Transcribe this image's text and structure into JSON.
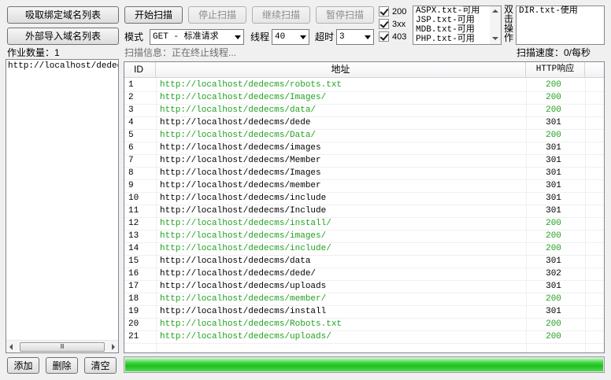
{
  "left_buttons": {
    "fetch_bound": "吸取绑定域名列表",
    "import_external": "外部导入域名列表"
  },
  "job_count_label": "作业数量：1",
  "job_list": [
    "http://localhost/dedecm"
  ],
  "bottom_buttons": {
    "add": "添加",
    "delete": "删除",
    "clear": "清空"
  },
  "toolbar": {
    "start": "开始扫描",
    "stop": "停止扫描",
    "resume": "继续扫描",
    "pause": "暂停扫描"
  },
  "options": {
    "mode_label": "模式",
    "mode_value": "GET - 标准请求",
    "threads_label": "线程",
    "threads_value": "40",
    "timeout_label": "超时",
    "timeout_value": "3"
  },
  "status_filters": [
    {
      "label": "200",
      "checked": true
    },
    {
      "label": "3xx",
      "checked": true
    },
    {
      "label": "403",
      "checked": true
    }
  ],
  "dictionaries": [
    "ASPX.txt-可用",
    "JSP.txt-可用",
    "MDB.txt-可用",
    "PHP.txt-可用"
  ],
  "dbl_click_hint": "双击操作",
  "dir_dictionary": "DIR.txt-使用",
  "scan_info": "扫描信息：正在终止线程...",
  "scan_speed": "扫描速度：0/每秒",
  "table": {
    "headers": {
      "id": "ID",
      "url": "地址",
      "code": "HTTP响应"
    },
    "rows": [
      {
        "id": "1",
        "url": "http://localhost/dedecms/robots.txt",
        "code": "200"
      },
      {
        "id": "2",
        "url": "http://localhost/dedecms/Images/",
        "code": "200"
      },
      {
        "id": "3",
        "url": "http://localhost/dedecms/data/",
        "code": "200"
      },
      {
        "id": "4",
        "url": "http://localhost/dedecms/dede",
        "code": "301"
      },
      {
        "id": "5",
        "url": "http://localhost/dedecms/Data/",
        "code": "200"
      },
      {
        "id": "6",
        "url": "http://localhost/dedecms/images",
        "code": "301"
      },
      {
        "id": "7",
        "url": "http://localhost/dedecms/Member",
        "code": "301"
      },
      {
        "id": "8",
        "url": "http://localhost/dedecms/Images",
        "code": "301"
      },
      {
        "id": "9",
        "url": "http://localhost/dedecms/member",
        "code": "301"
      },
      {
        "id": "10",
        "url": "http://localhost/dedecms/include",
        "code": "301"
      },
      {
        "id": "11",
        "url": "http://localhost/dedecms/Include",
        "code": "301"
      },
      {
        "id": "12",
        "url": "http://localhost/dedecms/install/",
        "code": "200"
      },
      {
        "id": "13",
        "url": "http://localhost/dedecms/images/",
        "code": "200"
      },
      {
        "id": "14",
        "url": "http://localhost/dedecms/include/",
        "code": "200"
      },
      {
        "id": "15",
        "url": "http://localhost/dedecms/data",
        "code": "301"
      },
      {
        "id": "16",
        "url": "http://localhost/dedecms/dede/",
        "code": "302"
      },
      {
        "id": "17",
        "url": "http://localhost/dedecms/uploads",
        "code": "301"
      },
      {
        "id": "18",
        "url": "http://localhost/dedecms/member/",
        "code": "200"
      },
      {
        "id": "19",
        "url": "http://localhost/dedecms/install",
        "code": "301"
      },
      {
        "id": "20",
        "url": "http://localhost/dedecms/Robots.txt",
        "code": "200"
      },
      {
        "id": "21",
        "url": "http://localhost/dedecms/uploads/",
        "code": "200"
      }
    ]
  },
  "progress": {
    "value": 1.0
  },
  "scroll_thumb_glyph": "Ⅲ",
  "colors": {
    "ok_green": "#21a121",
    "progress_green": "#29c229"
  }
}
